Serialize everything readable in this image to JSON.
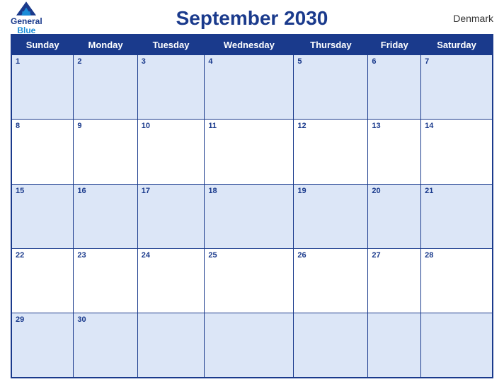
{
  "header": {
    "title": "September 2030",
    "country": "Denmark",
    "logo_general": "General",
    "logo_blue": "Blue"
  },
  "days_of_week": [
    "Sunday",
    "Monday",
    "Tuesday",
    "Wednesday",
    "Thursday",
    "Friday",
    "Saturday"
  ],
  "weeks": [
    [
      1,
      2,
      3,
      4,
      5,
      6,
      7
    ],
    [
      8,
      9,
      10,
      11,
      12,
      13,
      14
    ],
    [
      15,
      16,
      17,
      18,
      19,
      20,
      21
    ],
    [
      22,
      23,
      24,
      25,
      26,
      27,
      28
    ],
    [
      29,
      30,
      null,
      null,
      null,
      null,
      null
    ]
  ]
}
